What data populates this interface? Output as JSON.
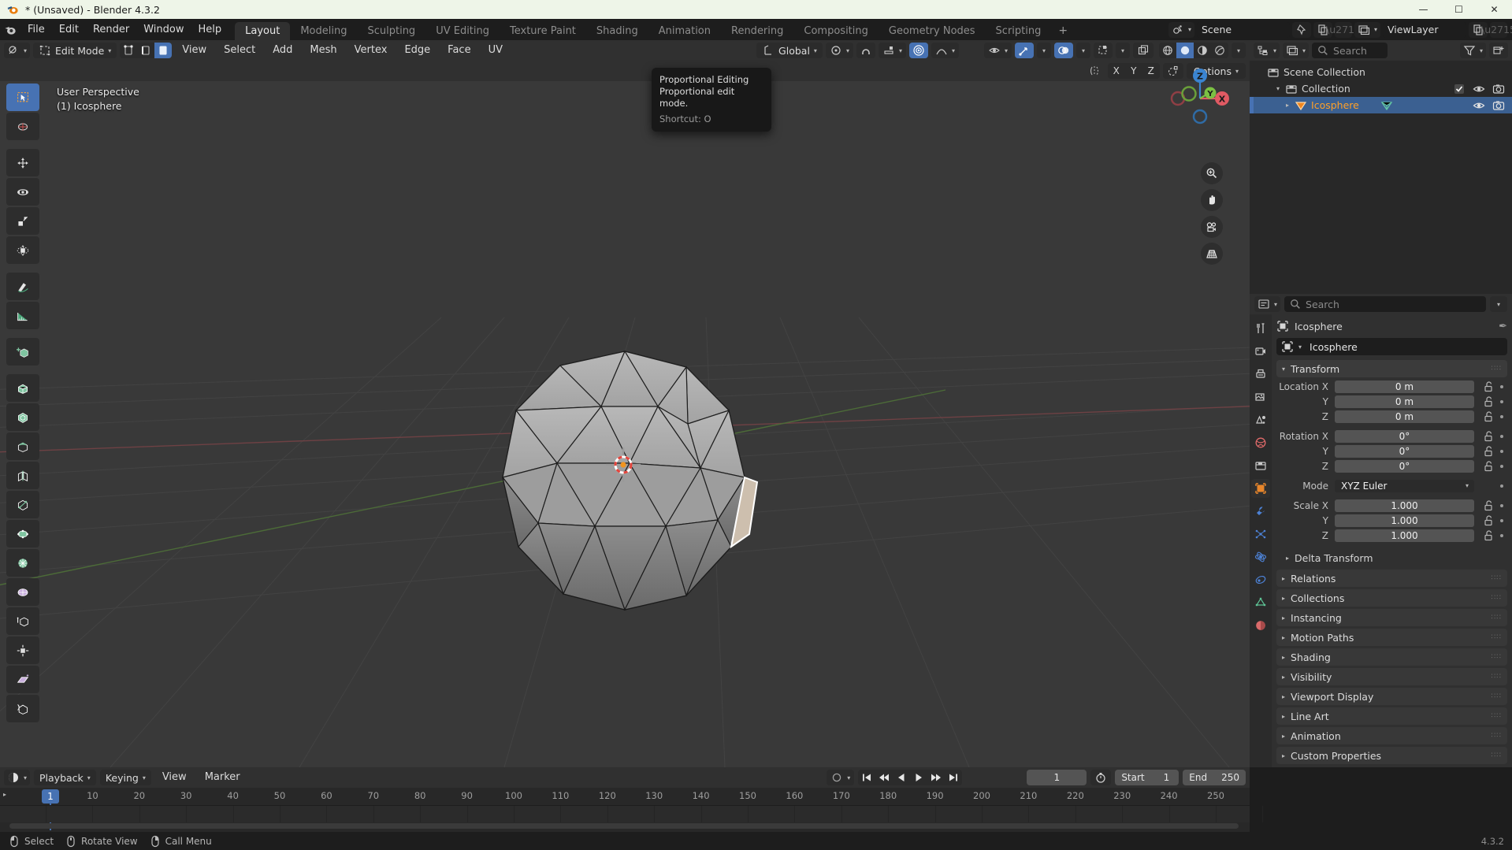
{
  "window": {
    "title": "* (Unsaved) - Blender 4.3.2",
    "minimize": "—",
    "maximize": "☐",
    "close": "✕"
  },
  "topbar": {
    "menus": [
      "File",
      "Edit",
      "Render",
      "Window",
      "Help"
    ],
    "workspaces": [
      "Layout",
      "Modeling",
      "Sculpting",
      "UV Editing",
      "Texture Paint",
      "Shading",
      "Animation",
      "Rendering",
      "Compositing",
      "Geometry Nodes",
      "Scripting"
    ],
    "active_workspace": "Layout",
    "add_workspace": "+",
    "scene_name": "Scene",
    "view_layer_name": "ViewLayer"
  },
  "viewport": {
    "mode": "Edit Mode",
    "menus": [
      "View",
      "Select",
      "Add",
      "Mesh",
      "Vertex",
      "Edge",
      "Face",
      "UV"
    ],
    "orientation": "Global",
    "proportional_enabled": true,
    "overlay_line1": "User Perspective",
    "overlay_line2": "(1) Icosphere",
    "options_label": "Options",
    "mirror_axes": [
      "X",
      "Y",
      "Z"
    ],
    "gizmo_axes": {
      "x": "X",
      "y": "Y",
      "z": "Z"
    },
    "object_name": "Icosphere"
  },
  "tooltip": {
    "title": "Proportional Editing",
    "description": "Proportional edit mode.",
    "shortcut": "Shortcut: O"
  },
  "toolbar_tools": [
    "tweak-tool",
    "cursor-tool",
    "move-tool",
    "rotate-tool",
    "scale-tool",
    "transform-tool",
    "annotate-tool",
    "measure-tool",
    "add-cube-tool",
    "extrude-region-tool",
    "inset-faces-tool",
    "bevel-tool",
    "loop-cut-tool",
    "knife-tool",
    "poly-build-tool",
    "spin-tool",
    "smooth-tool",
    "edge-slide-tool",
    "shrink-fatten-tool",
    "shear-tool",
    "rip-region-tool"
  ],
  "outliner": {
    "search_placeholder": "Search",
    "rows": [
      {
        "name": "Scene Collection",
        "indent": 0,
        "icon": "collection-icon",
        "selected": false,
        "expandable": false
      },
      {
        "name": "Collection",
        "indent": 1,
        "icon": "collection-icon",
        "selected": false,
        "expandable": true
      },
      {
        "name": "Icosphere",
        "indent": 2,
        "icon": "mesh-object-icon",
        "selected": true,
        "expandable": true
      }
    ]
  },
  "properties": {
    "search_placeholder": "Search",
    "breadcrumb": "Icosphere",
    "object_name": "Icosphere",
    "transform": {
      "title": "Transform",
      "rows": [
        {
          "label": "Location X",
          "value": "0 m"
        },
        {
          "label": "Y",
          "value": "0 m"
        },
        {
          "label": "Z",
          "value": "0 m"
        },
        {
          "label": "Rotation X",
          "value": "0°"
        },
        {
          "label": "Y",
          "value": "0°"
        },
        {
          "label": "Z",
          "value": "0°"
        }
      ],
      "mode_label": "Mode",
      "mode_value": "XYZ Euler",
      "scale_rows": [
        {
          "label": "Scale X",
          "value": "1.000"
        },
        {
          "label": "Y",
          "value": "1.000"
        },
        {
          "label": "Z",
          "value": "1.000"
        }
      ],
      "delta_transform": "Delta Transform"
    },
    "sections": [
      "Relations",
      "Collections",
      "Instancing",
      "Motion Paths",
      "Shading",
      "Visibility",
      "Viewport Display",
      "Line Art",
      "Animation",
      "Custom Properties"
    ],
    "tabs": [
      "tool-tab",
      "render-tab",
      "output-tab",
      "view-layer-tab",
      "scene-tab",
      "world-tab",
      "collection-tab",
      "object-tab",
      "modifiers-tab",
      "particles-tab",
      "physics-tab",
      "constraints-tab",
      "object-data-tab",
      "material-tab"
    ],
    "active_tab": "object-tab"
  },
  "timeline": {
    "menus": [
      "Playback",
      "Keying",
      "View",
      "Marker"
    ],
    "current_frame": "1",
    "start_label": "Start",
    "start_value": "1",
    "end_label": "End",
    "end_value": "250",
    "ticks": [
      10,
      20,
      30,
      40,
      50,
      60,
      70,
      80,
      90,
      100,
      110,
      120,
      130,
      140,
      150,
      160,
      170,
      180,
      190,
      200,
      210,
      220,
      230,
      240,
      250
    ],
    "playhead_frame": 1
  },
  "statusbar": {
    "items": [
      {
        "icon": "mouse-left-icon",
        "label": "Select"
      },
      {
        "icon": "mouse-middle-icon",
        "label": "Rotate View"
      },
      {
        "icon": "mouse-right-icon",
        "label": "Call Menu"
      }
    ],
    "version": "4.3.2"
  },
  "colors": {
    "accent_blue": "#4772b3",
    "selected_orange": "#ffa028",
    "axis_x": "#e05a63",
    "axis_y": "#7bc043",
    "axis_z": "#3b84d0"
  }
}
